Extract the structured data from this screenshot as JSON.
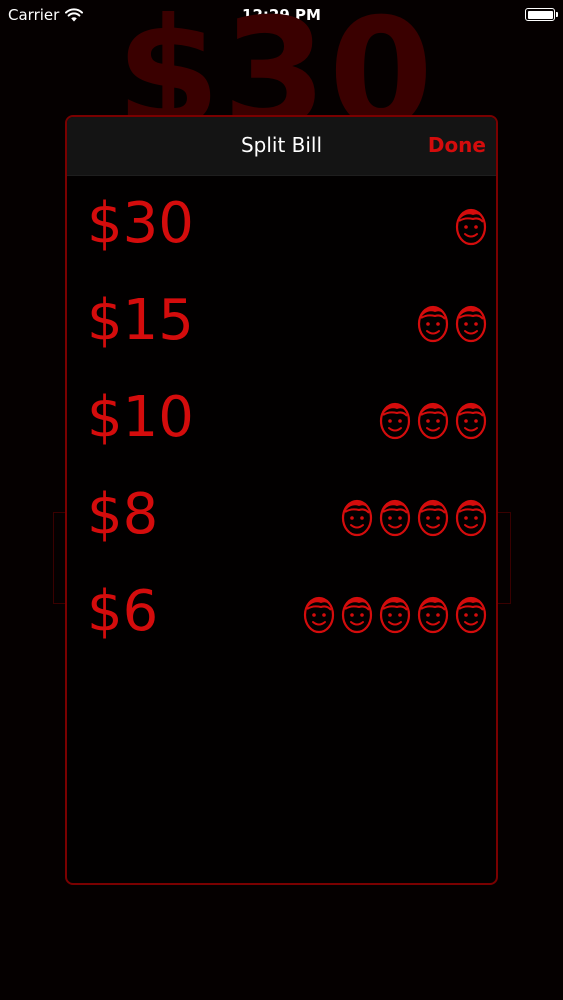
{
  "status_bar": {
    "carrier": "Carrier",
    "time": "12:29 PM"
  },
  "background": {
    "amount": "$30"
  },
  "modal": {
    "title": "Split Bill",
    "done_label": "Done",
    "rows": [
      {
        "amount": "$30",
        "people": 1
      },
      {
        "amount": "$15",
        "people": 2
      },
      {
        "amount": "$10",
        "people": 3
      },
      {
        "amount": "$8",
        "people": 4
      },
      {
        "amount": "$6",
        "people": 5
      }
    ]
  },
  "colors": {
    "accent": "#d40c0c",
    "background": "#050000",
    "border": "#7a0000"
  },
  "icons": {
    "person": "face-icon"
  }
}
